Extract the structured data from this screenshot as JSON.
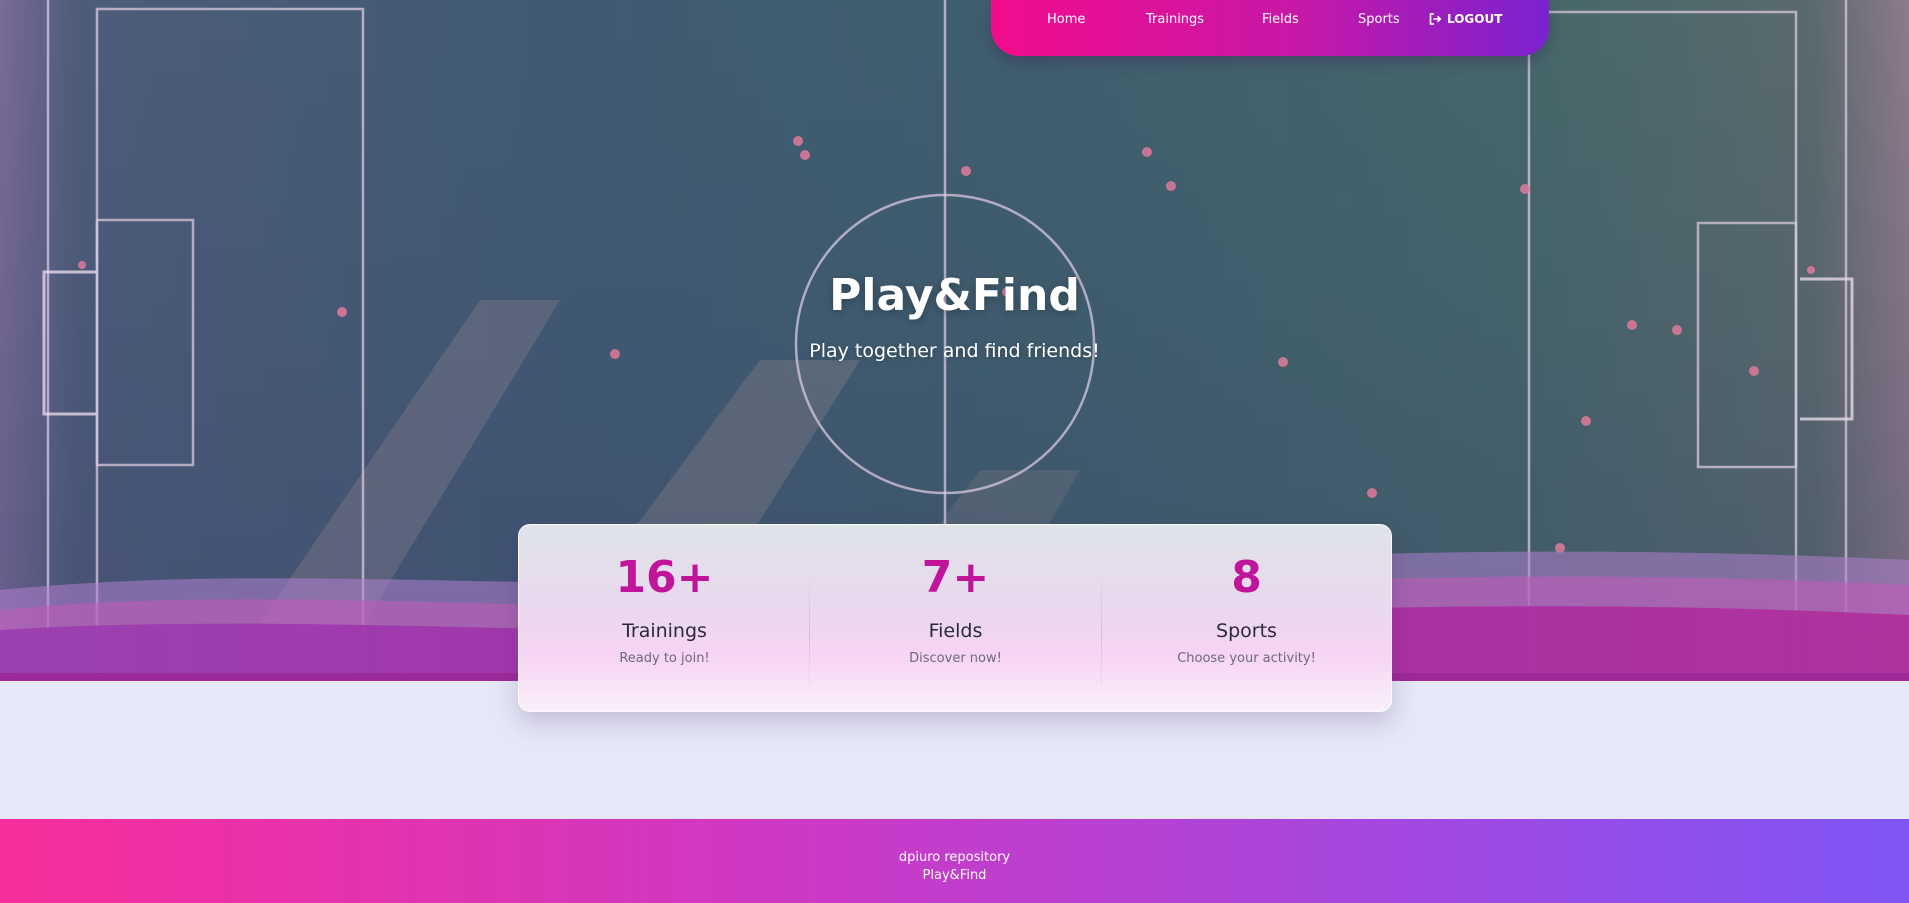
{
  "nav": {
    "items": [
      {
        "label": "Home"
      },
      {
        "label": "Trainings"
      },
      {
        "label": "Fields"
      },
      {
        "label": "Sports"
      }
    ],
    "logout": {
      "label": "LOGOUT",
      "icon": "logout-icon"
    }
  },
  "hero": {
    "title": "Play&Find",
    "subtitle": "Play together and find friends!"
  },
  "stats": [
    {
      "value": "16+",
      "label": "Trainings",
      "caption": "Ready to join!"
    },
    {
      "value": "7+",
      "label": "Fields",
      "caption": "Discover now!"
    },
    {
      "value": "8",
      "label": "Sports",
      "caption": "Choose your activity!"
    }
  ],
  "footer": {
    "line1": "dpiuro repository",
    "line2": "Play&Find"
  },
  "colors": {
    "accent_pink": "#f20c8c",
    "accent_purple": "#7a22d0",
    "stat_value": "#c0159a",
    "page_background": "#e6e7f7"
  }
}
